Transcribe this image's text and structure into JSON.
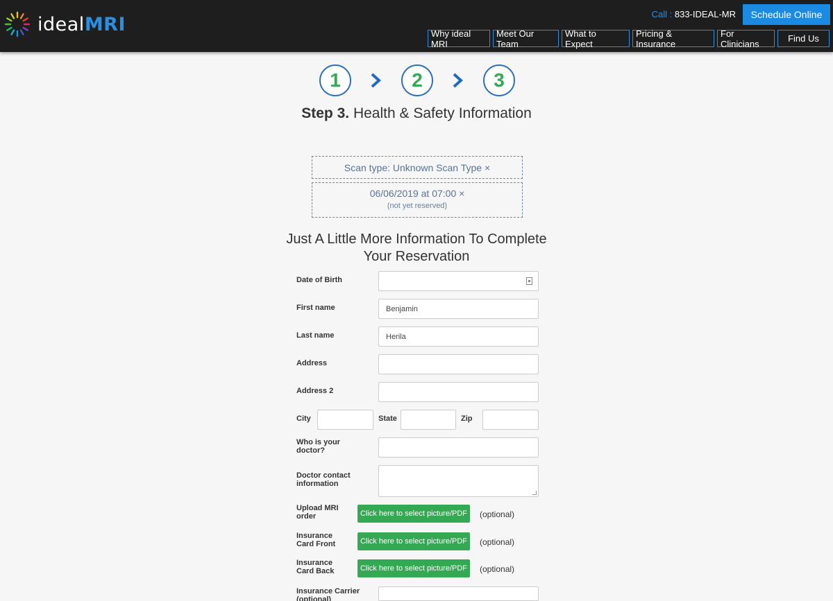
{
  "header": {
    "logo_ideal": "ideal",
    "logo_mri": "MRI",
    "call_label": "Call :",
    "call_number": "833-IDEAL-MR",
    "schedule_button": "Schedule Online",
    "nav": [
      "Why ideal MRI",
      "Meet Our Team",
      "What to Expect",
      "Pricing & Insurance",
      "For Clinicians",
      "Find Us"
    ]
  },
  "steps": {
    "items": [
      "1",
      "2",
      "3"
    ],
    "title_bold": "Step 3.",
    "title_rest": " Health & Safety Information"
  },
  "reservation": {
    "scan_type": "Scan type: Unknown Scan Type ×",
    "datetime": "06/06/2019 at 07:00 ×",
    "status": "(not yet reserved)"
  },
  "form": {
    "title": "Just A Little More Information To Complete Your Reservation",
    "dob_label": "Date of Birth",
    "dob_value": "",
    "first_name_label": "First name",
    "first_name_value": "Benjamin",
    "last_name_label": "Last name",
    "last_name_value": "Herila",
    "address_label": "Address",
    "address_value": "",
    "address2_label": "Address 2",
    "address2_value": "",
    "city_label": "City",
    "state_label": "State",
    "zip_label": "Zip",
    "doctor_label": "Who is your doctor?",
    "doctor_contact_label": "Doctor contact information",
    "upload_mri_label": "Upload MRI order",
    "insurance_front_label": "Insurance Card Front",
    "insurance_back_label": "Insurance Card Back",
    "upload_button": "Click here to select picture/PDF",
    "optional": "(optional)",
    "carrier_label": "Insurance Carrier (optional)"
  },
  "colors": {
    "header_bg": "#1e1e1e",
    "accent_blue": "#1a8ae3",
    "step_green": "#35a853",
    "step_border": "#2c6fbe"
  }
}
